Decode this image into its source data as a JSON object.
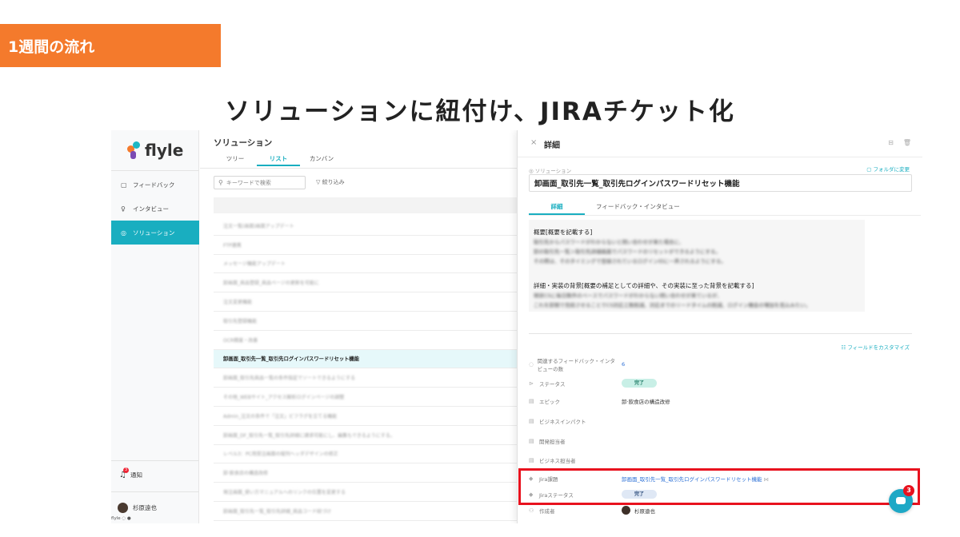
{
  "banner": {
    "text": "1週間の流れ"
  },
  "headline": "ソリューションに紐付け、JIRAチケット化",
  "sidebar": {
    "logo": "flyle",
    "items": [
      {
        "label": "フィードバック",
        "icon": "feedback-icon",
        "glyph": "▢"
      },
      {
        "label": "インタビュー",
        "icon": "microphone-icon",
        "glyph": "♀"
      },
      {
        "label": "ソリューション",
        "icon": "solution-icon",
        "glyph": "◎"
      }
    ],
    "notify_label": "通知",
    "notify_count": "3",
    "user_name": "杉原遠也",
    "version": "flyle ◌ ●"
  },
  "list": {
    "title": "ソリューション",
    "tabs": [
      "ツリー",
      "リスト",
      "カンバン"
    ],
    "search_placeholder": "キーワードで検索",
    "filter_label": "絞り込み",
    "rows": [
      "注文一覧(画面)画面アップデート",
      "FTP連携",
      "メッセージ機能アップデート",
      "卸画面_商品登録_商品ページの更新を可能に",
      "注文変更機能",
      "取引先登録機能",
      "OCR精度・改善",
      "卸画面_取引先一覧_取引先ログインパスワードリセット機能",
      "卸画面_取引先商品一覧の条件指定でソートできるようにする",
      "その他_WEBサイト_アクセス解析ログインページの調整",
      "Admin_注文の条件で「注文」ビフラグを立てる機能",
      "卸画面_DF_取引先一覧_取引先詳細に請求可能にし、編集もできるようにする。",
      "レベル3：PC用受注画面の縦列ヘッダデザインの修正",
      "卸·飲食店の構造改修",
      "発注画面_使い方マニュアルへのリンクの位置を変更する",
      "卸画面_取引先一覧_取引先詳細_商品コード紐づけ"
    ],
    "selected_index": 7
  },
  "detail": {
    "title": "詳細",
    "type_label": "ソリューション",
    "change_folder": "フォルダに変更",
    "name": "卸画面_取引先一覧_取引先ログインパスワードリセット機能",
    "tabs": [
      "詳細",
      "フィードバック・インタビュー"
    ],
    "desc_heading1": "概要[概要を記載する]",
    "desc_lines1": [
      "取引先からパスワードがわからないと問い合わせが来た場合に、",
      "卸の取引先一覧＞取引先詳細画面でパスワードのリセットができるようにする。",
      "その際は、そのタイミングで登録されているログインIDに一斉されるようにする。"
    ],
    "desc_heading2": "詳細・実装の背景[概要の補足としての詳細や、その実装に至った背景を記載する]",
    "desc_lines2": [
      "現状CSに毎日数件のペースでパスワードがわからない問い合わせが来ているが、",
      "これを卸側で完結させることでCS対応工数削減、対応までのリードタイムの削減、ログイン機会の増加を見込みたい。"
    ],
    "customize_fields": "フィールドをカスタマイズ",
    "fields": {
      "related_label": "関連するフィードバック・インタビューの数",
      "related_value": "6",
      "status_label": "ステータス",
      "status_value": "完了",
      "epic_label": "エピック",
      "epic_value": "卸·飲食店の構造改修",
      "impact_label": "ビジネスインパクト",
      "dev_owner_label": "開発担当者",
      "biz_owner_label": "ビジネス担当者",
      "jira_label": "Jira課題",
      "jira_value": "卸画面_取引先一覧_取引先ログインパスワードリセット機能",
      "jira_status_label": "Jiraステータス",
      "jira_status_value": "完了",
      "author_label": "作成者",
      "author_value": "杉原遠也"
    }
  },
  "chat": {
    "badge": "3"
  },
  "colors": {
    "accent": "#19aec0",
    "banner": "#f47a2c",
    "highlight": "#e8121e"
  }
}
